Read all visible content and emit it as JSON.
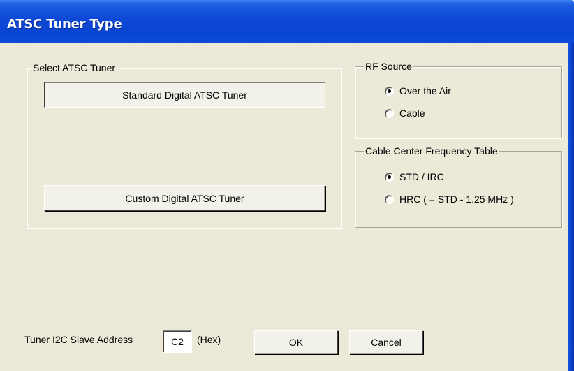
{
  "window": {
    "title": "ATSC Tuner Type"
  },
  "select_tuner": {
    "legend": "Select ATSC Tuner",
    "standard_button": "Standard Digital ATSC Tuner",
    "custom_button": "Custom Digital ATSC Tuner",
    "selected": "standard"
  },
  "rf_source": {
    "legend": "RF Source",
    "options": [
      {
        "label": "Over the Air",
        "checked": true
      },
      {
        "label": "Cable",
        "checked": false
      }
    ]
  },
  "cable_table": {
    "legend": "Cable Center Frequency Table",
    "options": [
      {
        "label": "STD / IRC",
        "checked": true
      },
      {
        "label": "HRC ( = STD - 1.25 MHz )",
        "checked": false
      }
    ]
  },
  "footer": {
    "address_label": "Tuner I2C Slave Address",
    "address_value": "C2",
    "hex_label": "(Hex)",
    "ok_label": "OK",
    "cancel_label": "Cancel"
  },
  "colors": {
    "titlebar": "#0a44d2",
    "dialog_face": "#ece9d8",
    "frame_edge": "#0831a8"
  }
}
